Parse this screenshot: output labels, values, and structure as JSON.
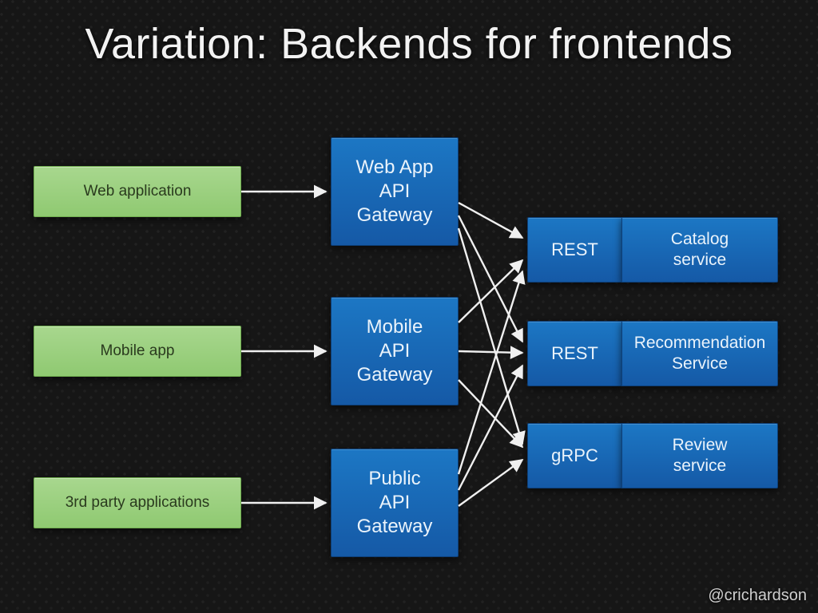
{
  "title": "Variation: Backends for frontends",
  "clients": {
    "web": "Web application",
    "mobile": "Mobile app",
    "public": "3rd party applications"
  },
  "gateways": {
    "web": "Web App\nAPI\nGateway",
    "mobile": "Mobile\nAPI\nGateway",
    "public": "Public\nAPI\nGateway"
  },
  "services": {
    "catalog": {
      "protocol": "REST",
      "name": "Catalog\nservice"
    },
    "recommendation": {
      "protocol": "REST",
      "name": "Recommendation\nService"
    },
    "review": {
      "protocol": "gRPC",
      "name": "Review\nservice"
    }
  },
  "attribution": "@crichardson"
}
